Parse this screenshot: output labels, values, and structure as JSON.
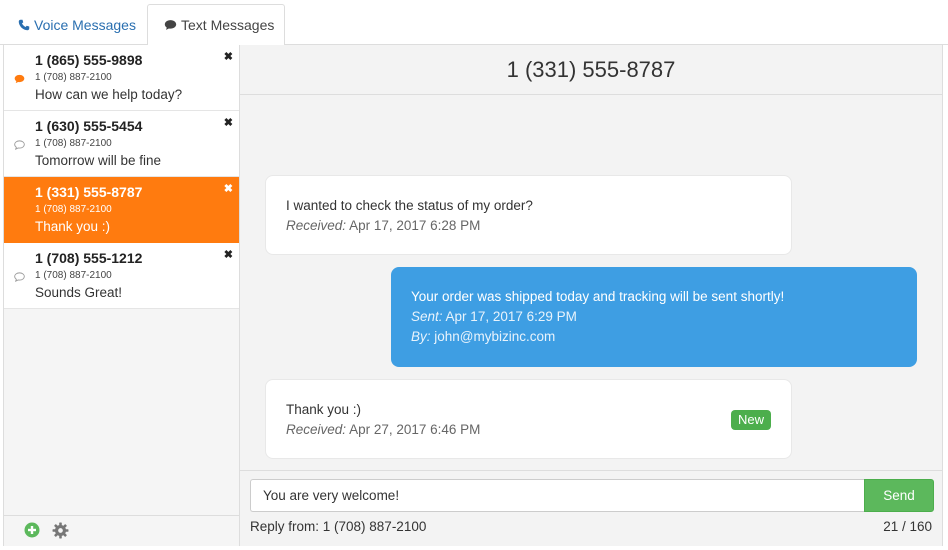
{
  "tabs": {
    "voice_label": "Voice Messages",
    "text_label": "Text Messages",
    "voice_icon": "phone-icon",
    "text_icon": "speech-bubble-icon"
  },
  "conversations": [
    {
      "number": "1 (865) 555-9898",
      "line": "1 (708) 887-2100",
      "preview": "How can we help today?",
      "close": "✖",
      "unread": true,
      "active": false
    },
    {
      "number": "1 (630) 555-5454",
      "line": "1 (708) 887-2100",
      "preview": "Tomorrow will be fine",
      "close": "✖",
      "unread": false,
      "active": false
    },
    {
      "number": "1 (331) 555-8787",
      "line": "1 (708) 887-2100",
      "preview": "Thank you :)",
      "close": "✖",
      "unread": false,
      "active": true
    },
    {
      "number": "1 (708) 555-1212",
      "line": "1 (708) 887-2100",
      "preview": "Sounds Great!",
      "close": "✖",
      "unread": false,
      "active": false
    }
  ],
  "footer": {
    "add_icon": "plus-circle-icon",
    "settings_icon": "gear-icon"
  },
  "thread": {
    "title": "1 (331) 555-8787",
    "messages": [
      {
        "direction": "in",
        "text": "I wanted to check the status of my order?",
        "meta_label": "Received:",
        "meta_value": "Apr 17, 2017 6:28 PM"
      },
      {
        "direction": "out",
        "text": "Your order was shipped today and tracking will be sent shortly!",
        "meta_label": "Sent:",
        "meta_value": "Apr 17, 2017 6:29 PM",
        "by_label": "By:",
        "by_value": "john@mybizinc.com"
      },
      {
        "direction": "in",
        "text": "Thank you :)",
        "meta_label": "Received:",
        "meta_value": "Apr 27, 2017 6:46 PM",
        "badge": "New"
      }
    ]
  },
  "compose": {
    "value": "You are very welcome!",
    "send_label": "Send",
    "reply_from": "Reply from: 1 (708) 887-2100",
    "counter": "21 / 160"
  },
  "colors": {
    "accent": "#ff7b0f",
    "outgoing": "#3e9ee3",
    "send": "#5cb85c",
    "link": "#2a6fb0"
  }
}
